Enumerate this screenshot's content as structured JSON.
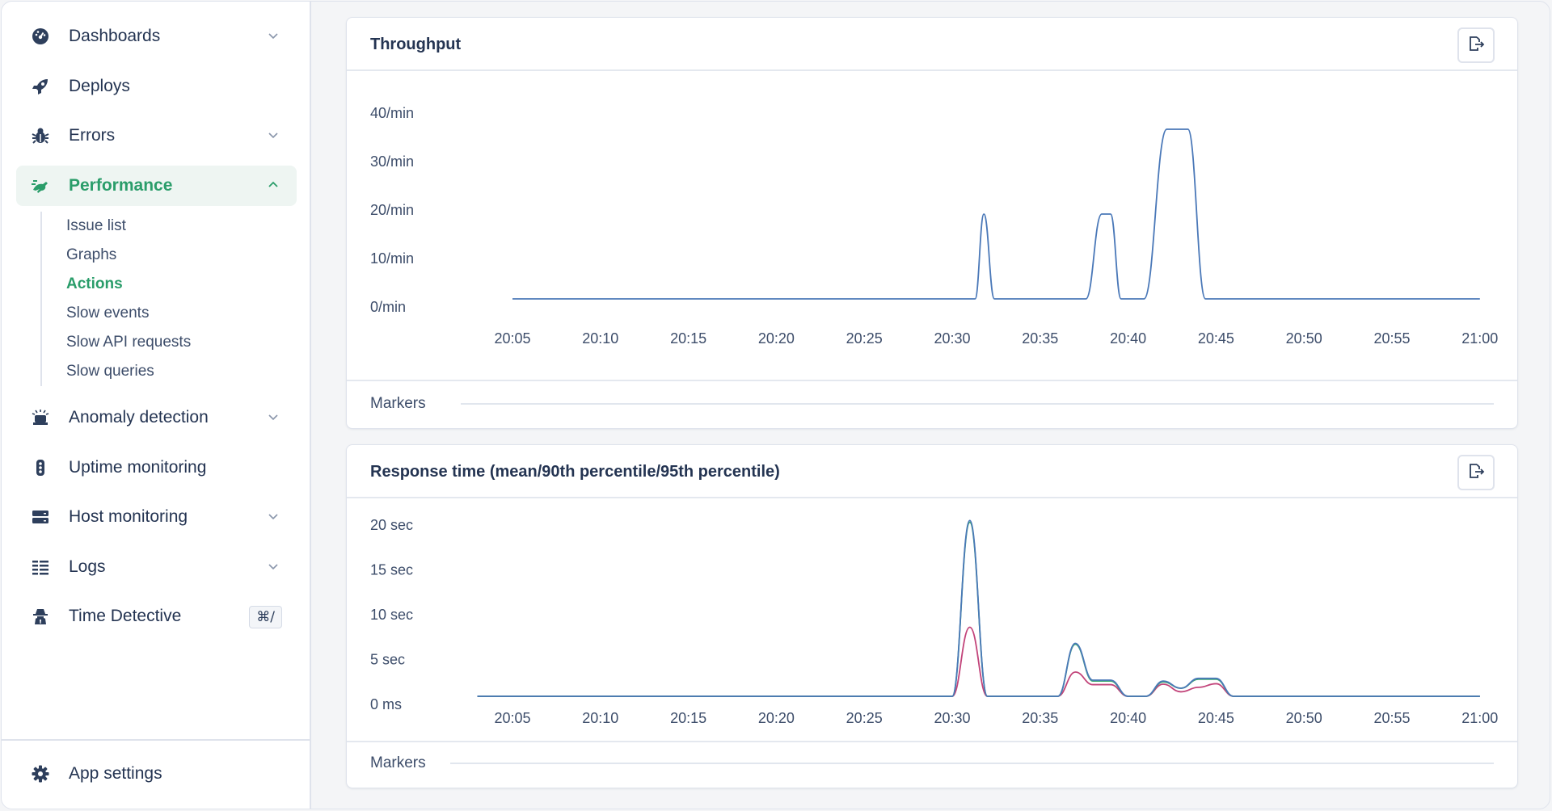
{
  "sidebar": {
    "items": [
      {
        "label": "Dashboards",
        "icon": "dashboard-gauge-icon",
        "has_chevron": true
      },
      {
        "label": "Deploys",
        "icon": "rocket-icon",
        "has_chevron": false
      },
      {
        "label": "Errors",
        "icon": "bug-icon",
        "has_chevron": true
      },
      {
        "label": "Performance",
        "icon": "performance-runner-icon",
        "has_chevron": true,
        "active": true,
        "expanded": true
      },
      {
        "label": "Anomaly detection",
        "icon": "siren-icon",
        "has_chevron": true
      },
      {
        "label": "Uptime monitoring",
        "icon": "traffic-light-icon",
        "has_chevron": false
      },
      {
        "label": "Host monitoring",
        "icon": "server-icon",
        "has_chevron": true
      },
      {
        "label": "Logs",
        "icon": "logs-list-icon",
        "has_chevron": true
      },
      {
        "label": "Time Detective",
        "icon": "detective-icon",
        "has_chevron": false,
        "shortcut": "⌘/"
      }
    ],
    "performance_subitems": [
      {
        "label": "Issue list"
      },
      {
        "label": "Graphs"
      },
      {
        "label": "Actions",
        "active": true
      },
      {
        "label": "Slow events"
      },
      {
        "label": "Slow API requests"
      },
      {
        "label": "Slow queries"
      }
    ],
    "footer": {
      "label": "App settings",
      "icon": "gear-icon"
    }
  },
  "colors": {
    "accent": "#2a9d6a",
    "text": "#243452",
    "line_blue": "#4a78b8",
    "line_green": "#3aa870",
    "line_red": "#c2447a"
  },
  "cards": [
    {
      "title": "Throughput",
      "markers_label": "Markers",
      "export_icon": "export-file-icon"
    },
    {
      "title": "Response time (mean/90th percentile/95th percentile)",
      "markers_label": "Markers",
      "export_icon": "export-file-icon"
    }
  ],
  "chart_data": [
    {
      "type": "line",
      "title": "Throughput",
      "xlabel": "",
      "ylabel": "",
      "x_ticks": [
        "20:05",
        "20:10",
        "20:15",
        "20:20",
        "20:25",
        "20:30",
        "20:35",
        "20:40",
        "20:45",
        "20:50",
        "20:55",
        "21:00"
      ],
      "y_ticks": [
        "0/min",
        "10/min",
        "20/min",
        "30/min",
        "40/min"
      ],
      "xlim_minutes": [
        0,
        55
      ],
      "ylim": [
        0,
        40
      ],
      "grid": false,
      "x_minutes_from_2005": [
        0,
        26.3,
        26.8,
        27.4,
        31.1,
        32.6,
        33.5,
        34.0,
        34.6,
        35.4,
        35.9,
        37.2,
        38.4,
        39.4,
        45.3,
        46.3,
        55
      ],
      "series": [
        {
          "name": "Throughput",
          "color": "#4a78b8",
          "values": [
            0,
            0,
            17.5,
            0,
            0,
            0,
            17.5,
            17.5,
            0,
            0,
            0,
            35,
            35,
            0,
            0,
            0,
            0
          ]
        }
      ]
    },
    {
      "type": "line",
      "title": "Response time (mean/90th percentile/95th percentile)",
      "xlabel": "",
      "ylabel": "",
      "x_ticks": [
        "20:05",
        "20:10",
        "20:15",
        "20:20",
        "20:25",
        "20:30",
        "20:35",
        "20:40",
        "20:45",
        "20:50",
        "20:55",
        "21:00"
      ],
      "y_ticks": [
        "0 ms",
        "5 sec",
        "10 sec",
        "15 sec",
        "20 sec"
      ],
      "xlim_minutes": [
        0,
        55
      ],
      "ylim_sec": [
        0,
        20
      ],
      "grid": false,
      "x_minutes_from_2005": [
        -2,
        25.0,
        26.0,
        27.0,
        31.0,
        32.0,
        33.0,
        34.0,
        35.0,
        36.0,
        37.0,
        38.0,
        39.0,
        40.0,
        41.0,
        55
      ],
      "series": [
        {
          "name": "95th percentile",
          "color": "#4a78b8",
          "values": [
            0,
            0,
            19.6,
            0,
            0,
            5.9,
            1.8,
            1.8,
            0,
            0,
            1.7,
            0.9,
            2.0,
            2.0,
            0,
            0
          ]
        },
        {
          "name": "90th percentile",
          "color": "#3aa870",
          "values": [
            0,
            0,
            19.4,
            0,
            0,
            5.8,
            1.7,
            1.7,
            0,
            0,
            1.6,
            0.9,
            1.9,
            1.9,
            0,
            0
          ]
        },
        {
          "name": "mean",
          "color": "#c2447a",
          "values": [
            0,
            0,
            7.7,
            0,
            0,
            2.7,
            1.3,
            1.3,
            0,
            0,
            1.35,
            0.5,
            1.0,
            1.4,
            0,
            0
          ]
        }
      ]
    }
  ]
}
